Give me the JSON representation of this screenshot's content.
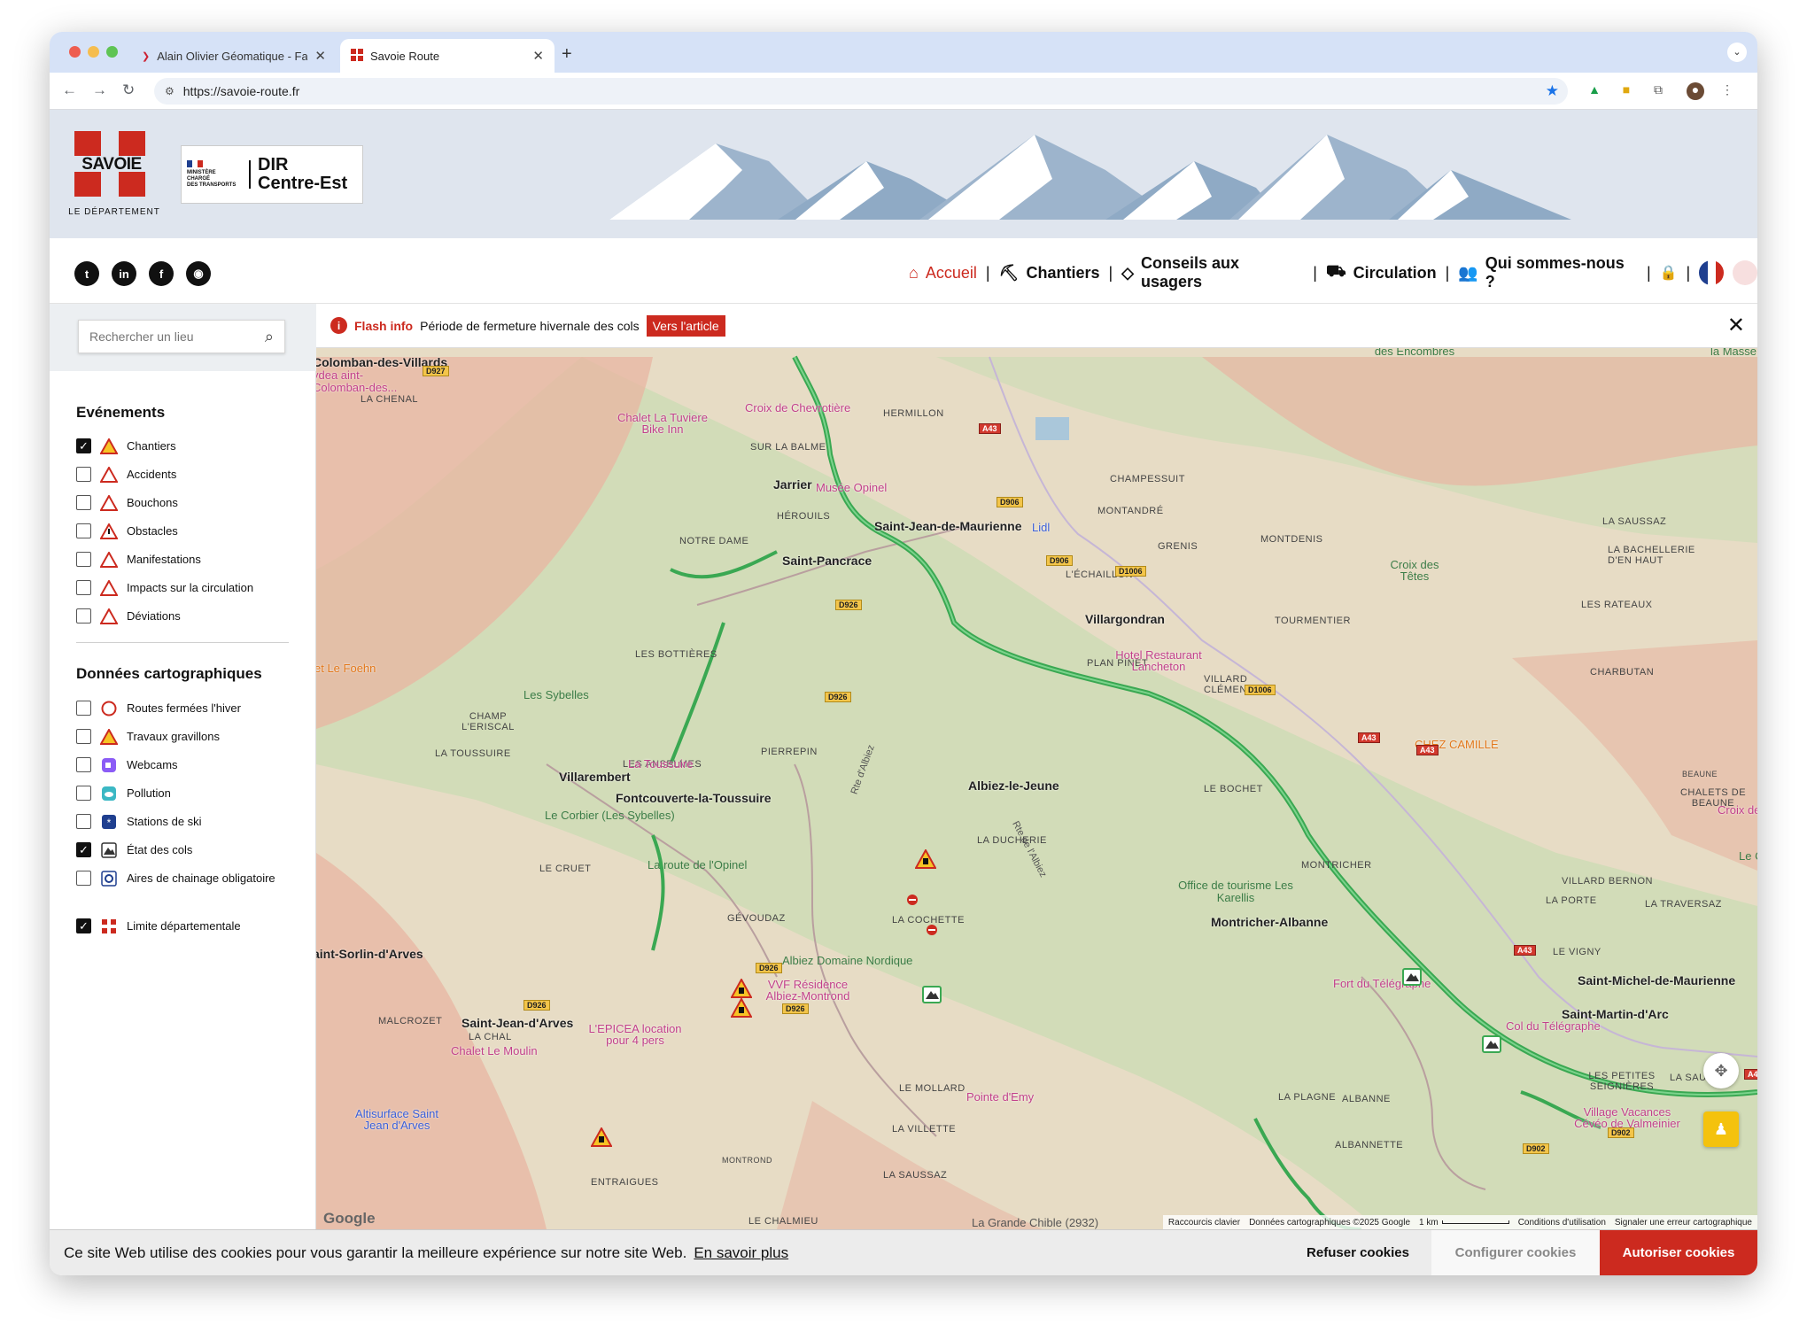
{
  "browser": {
    "tabs": [
      {
        "title": "Alain Olivier Géomatique - Fa",
        "active": false
      },
      {
        "title": "Savoie Route",
        "active": true
      }
    ],
    "url": "https://savoie-route.fr"
  },
  "header": {
    "savoie_logo_text": "SAVOIE",
    "savoie_subtitle": "LE DÉPARTEMENT",
    "ministry_lines": [
      "MINISTÈRE",
      "CHARGÉ",
      "DES TRANSPORTS"
    ],
    "dir_name_line1": "DIR",
    "dir_name_line2": "Centre-Est"
  },
  "nav": {
    "social": [
      "twitter-icon",
      "linkedin-icon",
      "facebook-icon",
      "rss-icon"
    ],
    "items": [
      {
        "label": "Accueil",
        "icon": "home-icon",
        "active": true
      },
      {
        "label": "Chantiers",
        "icon": "roadworks-icon"
      },
      {
        "label": "Conseils aux usagers",
        "icon": "diamond-sign-icon"
      },
      {
        "label": "Circulation",
        "icon": "car-icon"
      },
      {
        "label": "Qui sommes-nous ?",
        "icon": "people-icon"
      }
    ],
    "separator": "|"
  },
  "sidebar": {
    "search_placeholder": "Rechercher un lieu",
    "events_title": "Evénements",
    "events": [
      {
        "label": "Chantiers",
        "checked": true
      },
      {
        "label": "Accidents",
        "checked": false
      },
      {
        "label": "Bouchons",
        "checked": false
      },
      {
        "label": "Obstacles",
        "checked": false
      },
      {
        "label": "Manifestations",
        "checked": false
      },
      {
        "label": "Impacts sur la circulation",
        "checked": false
      },
      {
        "label": "Déviations",
        "checked": false
      }
    ],
    "map_title": "Données cartographiques",
    "map_layers": [
      {
        "label": "Routes fermées l'hiver",
        "checked": false
      },
      {
        "label": "Travaux gravillons",
        "checked": false
      },
      {
        "label": "Webcams",
        "checked": false
      },
      {
        "label": "Pollution",
        "checked": false
      },
      {
        "label": "Stations de ski",
        "checked": false
      },
      {
        "label": "État des cols",
        "checked": true
      },
      {
        "label": "Aires de chainage obligatoire",
        "checked": false
      },
      {
        "label": "Limite départementale",
        "checked": true
      }
    ]
  },
  "flash": {
    "label": "Flash info",
    "text": "Période de fermeture hivernale des cols",
    "button": "Vers l'article"
  },
  "map": {
    "places_caps": [
      "LA CHENAL",
      "HERMILLON",
      "SUR LA BALME",
      "CHAMPESSUIT",
      "HÉROUILS",
      "MONTANDRÉ",
      "NOTRE DAME",
      "GRENIS",
      "MONTDENIS",
      "L'ÉCHAILLON",
      "LA SAUSSAZ",
      "LA BACHELLERIE D'EN HAUT",
      "LES RATEAUX",
      "LES BOTTIÈRES",
      "PLAN PINET",
      "TOURMENTIER",
      "VILLARD CLÉMENT",
      "CHARBUTAN",
      "CHAMP L'ERISCAL",
      "LA TOUSSUIRE",
      "LES ANSELMES",
      "PIERREPIN",
      "LE BOCHET",
      "BEAUNE",
      "CHALETS DE BEAUNE",
      "LA DUCHERIE",
      "LE CRUET",
      "MONTRICHER",
      "VILLARD BERNON",
      "LA PORTE",
      "LA TRAVERSAZ",
      "GÉVOUDAZ",
      "LA COCHETTE",
      "LE VIGNY",
      "MALCROZET",
      "LA CHAL",
      "LE MOLLARD",
      "LA PLAGNE",
      "ALBANNE",
      "LES PETITES SEIGNIÈRES",
      "LA SAUSSAZ",
      "LA VILLETTE",
      "ALBANNETTE",
      "MONTROND",
      "LA SAUSSAZ",
      "ENTRAIGUES",
      "LE CHALMIEU"
    ],
    "towns": [
      "Colomban-des-Villards",
      "Jarrier",
      "Saint-Jean-de-Maurienne",
      "Saint-Pancrace",
      "Villargondran",
      "Villarembert",
      "Fontcouverte-la-Toussuire",
      "Albiez-le-Jeune",
      "Montricher-Albanne",
      "aint-Sorlin-d'Arves",
      "Saint-Michel-de-Maurienne",
      "Saint-Martin-d'Arc",
      "Saint-Jean-d'Arves"
    ],
    "pois": [
      "Chalet La Tuviere Bike Inn",
      "Croix de Chevrotière",
      "Musée Opinel",
      "Lidl",
      "Hotel Restaurant Lancheton",
      "La Toussuire",
      "CHEZ CAMILLE",
      "VVF Résidence Albiez-Montrond",
      "L'EPICEA location pour 4 pers",
      "Chalet Le Moulin",
      "Pointe d'Emy",
      "Fort du Télégraphe",
      "Col du Télégraphe",
      "Village Vacances Cévéo de Valmeinier",
      "Altisurface Saint Jean d'Arves",
      "et Le Foehn",
      "Croix de Beaumo",
      "ydea aint-Colomban-des..."
    ],
    "green": [
      "Le Grand Perron des Encombres",
      "Pointe de la Masse",
      "Croix des Têtes",
      "Les Sybelles",
      "Le Corbier (Les Sybelles)",
      "La route de l'Opinel",
      "Office de tourisme Les Karellis",
      "Albiez Domaine Nordique",
      "Le C",
      "La Grande Chible (2932)"
    ],
    "roads": [
      "D927",
      "A43",
      "D906",
      "D906",
      "D1006",
      "D926",
      "D926",
      "D1006",
      "A43",
      "A43",
      "A43",
      "D926",
      "D926",
      "D926",
      "A43",
      "D902",
      "D902"
    ],
    "road_names": [
      "Rte d'Albiez",
      "Rte de l'Albiez"
    ],
    "attribution": [
      "Raccourcis clavier",
      "Données cartographiques ©2025 Google",
      "1 km",
      "Conditions d'utilisation",
      "Signaler une erreur cartographique"
    ],
    "google": "Google"
  },
  "cookie": {
    "text": "Ce site Web utilise des cookies pour vous garantir la meilleure expérience sur notre site Web.",
    "link": "En savoir plus",
    "refuse": "Refuser cookies",
    "configure": "Configurer cookies",
    "accept": "Autoriser cookies"
  },
  "colors": {
    "brand_red": "#cc2a1f",
    "route_green": "#3aa852"
  }
}
